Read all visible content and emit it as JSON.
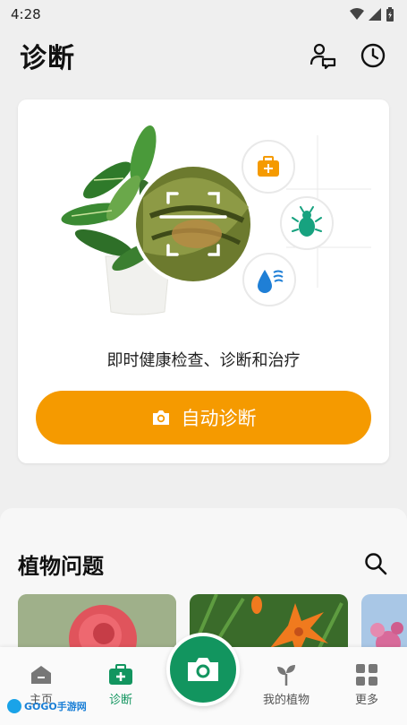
{
  "status_bar": {
    "time": "4:28",
    "icons": [
      "wifi-icon",
      "signal-icon",
      "battery-icon"
    ]
  },
  "header": {
    "title": "诊断",
    "actions": [
      "expert-chat-icon",
      "history-clock-icon"
    ]
  },
  "diagnosis_card": {
    "caption": "即时健康检查、诊断和治疗",
    "button_label": "自动诊断",
    "badges": [
      "first-aid-kit-icon",
      "bug-icon",
      "water-drop-icon"
    ]
  },
  "problems_section": {
    "title": "植物问题",
    "search_icon": "search-icon",
    "thumbnails": [
      "rose",
      "lily",
      "flower"
    ]
  },
  "bottom_nav": {
    "items": [
      {
        "label": "主页",
        "icon": "home-icon"
      },
      {
        "label": "诊断",
        "icon": "diagnosis-kit-icon"
      },
      {
        "label": "我的植物",
        "icon": "sprout-icon"
      },
      {
        "label": "更多",
        "icon": "grid-icon"
      }
    ],
    "active": "诊断",
    "fab_icon": "camera-icon"
  },
  "watermark": {
    "logo_text": "GOGO手游网"
  },
  "colors": {
    "accent_green": "#12955f",
    "accent_orange": "#f59a00",
    "badge_blue": "#1f7fd6"
  }
}
